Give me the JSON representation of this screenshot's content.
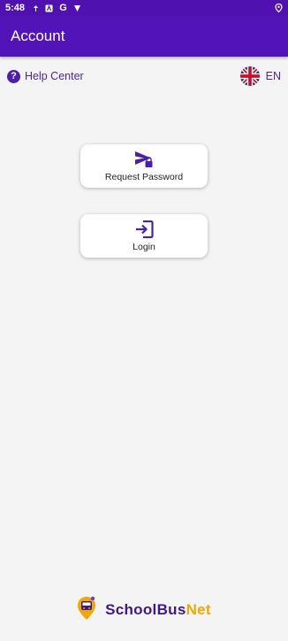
{
  "status_bar": {
    "time": "5:48",
    "icons": [
      "signal-icon",
      "a-box-icon",
      "google-icon",
      "signal-alt-icon"
    ],
    "right_icon": "location-icon"
  },
  "app_bar": {
    "title": "Account"
  },
  "help": {
    "label": "Help Center",
    "icon": "?"
  },
  "language": {
    "code": "EN",
    "flag": "uk-flag-icon"
  },
  "cards": [
    {
      "label": "Request Password",
      "icon": "send-lock-icon"
    },
    {
      "label": "Login",
      "icon": "login-icon"
    }
  ],
  "brand": {
    "part1": "SchoolBus",
    "part2": "Net"
  },
  "colors": {
    "primary": "#5214b8",
    "accent": "#4b1fa8",
    "brand_gold": "#f0a800",
    "background": "#f4f4f4"
  }
}
